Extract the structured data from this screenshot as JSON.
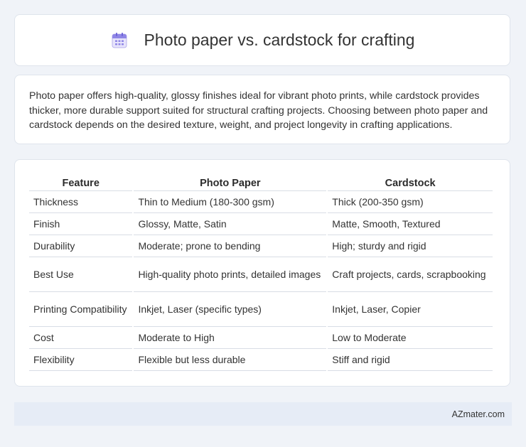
{
  "header": {
    "title": "Photo paper vs. cardstock for crafting",
    "icon": "calendar-icon"
  },
  "intro": {
    "text": "Photo paper offers high-quality, glossy finishes ideal for vibrant photo prints, while cardstock provides thicker, more durable support suited for structural crafting projects. Choosing between photo paper and cardstock depends on the desired texture, weight, and project longevity in crafting applications."
  },
  "table": {
    "headers": [
      "Feature",
      "Photo Paper",
      "Cardstock"
    ],
    "rows": [
      [
        "Thickness",
        "Thin to Medium (180-300 gsm)",
        "Thick (200-350 gsm)"
      ],
      [
        "Finish",
        "Glossy, Matte, Satin",
        "Matte, Smooth, Textured"
      ],
      [
        "Durability",
        "Moderate; prone to bending",
        "High; sturdy and rigid"
      ],
      [
        "Best Use",
        "High-quality photo prints, detailed images",
        "Craft projects, cards, scrapbooking"
      ],
      [
        "Printing Compatibility",
        "Inkjet, Laser (specific types)",
        "Inkjet, Laser, Copier"
      ],
      [
        "Cost",
        "Moderate to High",
        "Low to Moderate"
      ],
      [
        "Flexibility",
        "Flexible but less durable",
        "Stiff and rigid"
      ]
    ]
  },
  "footer": {
    "brand": "AZmater.com"
  }
}
